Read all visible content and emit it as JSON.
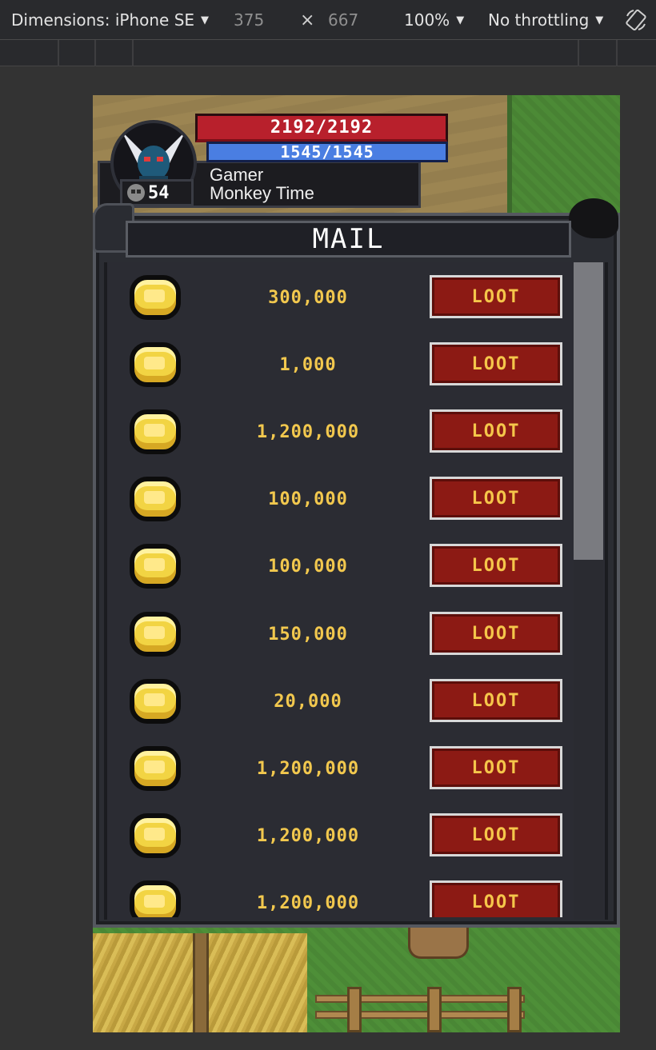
{
  "devtools": {
    "dimensions_label": "Dimensions: iPhone SE",
    "width": "375",
    "times": "×",
    "height": "667",
    "zoom": "100%",
    "throttling": "No throttling"
  },
  "hud": {
    "hp": "2192/2192",
    "mp": "1545/1545",
    "level": "54",
    "player_name_line1": "Gamer",
    "player_name_line2": "Monkey Time"
  },
  "mail": {
    "title": "MAIL",
    "items": [
      {
        "amount": "300,000",
        "button": "LOOT"
      },
      {
        "amount": "1,000",
        "button": "LOOT"
      },
      {
        "amount": "1,200,000",
        "button": "LOOT"
      },
      {
        "amount": "100,000",
        "button": "LOOT"
      },
      {
        "amount": "100,000",
        "button": "LOOT"
      },
      {
        "amount": "150,000",
        "button": "LOOT"
      },
      {
        "amount": "20,000",
        "button": "LOOT"
      },
      {
        "amount": "1,200,000",
        "button": "LOOT"
      },
      {
        "amount": "1,200,000",
        "button": "LOOT"
      },
      {
        "amount": "1,200,000",
        "button": "LOOT"
      }
    ]
  },
  "colors": {
    "hp_bar": "#b8202c",
    "mp_bar": "#4a7ee2",
    "loot_button": "#8c1a14",
    "gold_text": "#f2c84e"
  },
  "icons": {
    "coin": "gold-coin-icon",
    "level": "skull-icon",
    "rotate": "rotate-device-icon"
  }
}
